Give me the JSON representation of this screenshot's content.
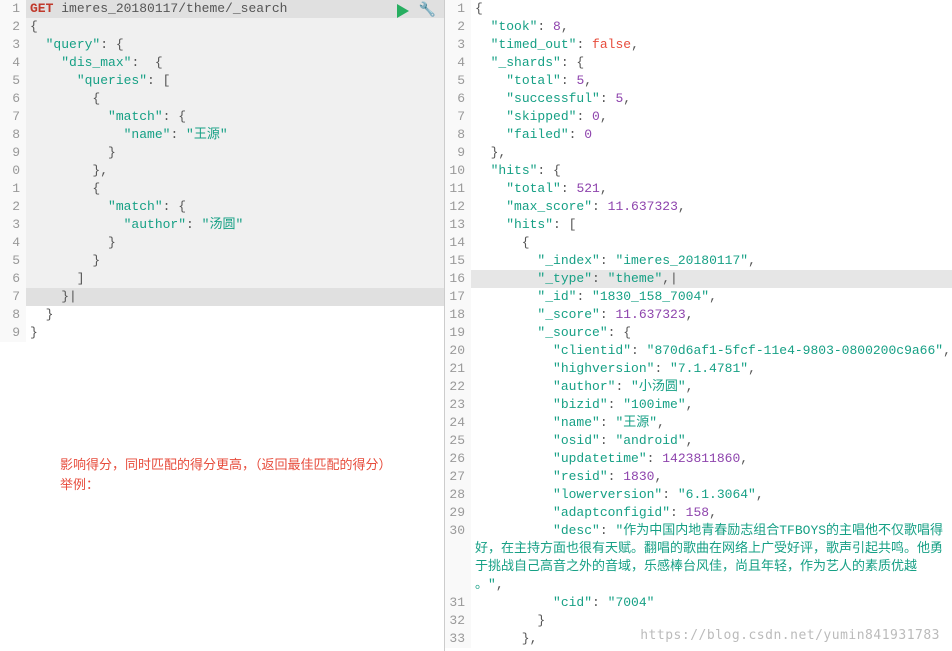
{
  "left": {
    "method": "GET",
    "endpoint": "imeres_20180117/theme/_search",
    "lines": [
      {
        "n": "1",
        "hl": true,
        "tokens": [
          {
            "t": "GET",
            "c": "method"
          },
          {
            "t": " "
          },
          {
            "t": "imeres_20180117/theme/_search",
            "c": "path"
          }
        ]
      },
      {
        "n": "2",
        "tokens": [
          {
            "t": "{",
            "c": "punc"
          }
        ]
      },
      {
        "n": "3",
        "tokens": [
          {
            "t": "  "
          },
          {
            "t": "\"query\"",
            "c": "key"
          },
          {
            "t": ": {",
            "c": "punc"
          }
        ]
      },
      {
        "n": "4",
        "tokens": [
          {
            "t": "    "
          },
          {
            "t": "\"dis_max\"",
            "c": "key"
          },
          {
            "t": ":  {",
            "c": "punc"
          }
        ]
      },
      {
        "n": "5",
        "tokens": [
          {
            "t": "      "
          },
          {
            "t": "\"queries\"",
            "c": "key"
          },
          {
            "t": ": [",
            "c": "punc"
          }
        ]
      },
      {
        "n": "6",
        "tokens": [
          {
            "t": "        {",
            "c": "punc"
          }
        ]
      },
      {
        "n": "7",
        "tokens": [
          {
            "t": "          "
          },
          {
            "t": "\"match\"",
            "c": "key"
          },
          {
            "t": ": {",
            "c": "punc"
          }
        ]
      },
      {
        "n": "8",
        "tokens": [
          {
            "t": "            "
          },
          {
            "t": "\"name\"",
            "c": "key"
          },
          {
            "t": ": ",
            "c": "punc"
          },
          {
            "t": "\"王源\"",
            "c": "str"
          }
        ]
      },
      {
        "n": "9",
        "tokens": [
          {
            "t": "          }",
            "c": "punc"
          }
        ]
      },
      {
        "n": "0",
        "tokens": [
          {
            "t": "        },",
            "c": "punc"
          }
        ]
      },
      {
        "n": "1",
        "tokens": [
          {
            "t": "        {",
            "c": "punc"
          }
        ]
      },
      {
        "n": "2",
        "tokens": [
          {
            "t": "          "
          },
          {
            "t": "\"match\"",
            "c": "key"
          },
          {
            "t": ": {",
            "c": "punc"
          }
        ]
      },
      {
        "n": "3",
        "tokens": [
          {
            "t": "            "
          },
          {
            "t": "\"author\"",
            "c": "key"
          },
          {
            "t": ": ",
            "c": "punc"
          },
          {
            "t": "\"汤圆\"",
            "c": "str"
          }
        ]
      },
      {
        "n": "4",
        "tokens": [
          {
            "t": "          }",
            "c": "punc"
          }
        ]
      },
      {
        "n": "5",
        "tokens": [
          {
            "t": "        }",
            "c": "punc"
          }
        ]
      },
      {
        "n": "6",
        "tokens": [
          {
            "t": "      ]",
            "c": "punc"
          }
        ]
      },
      {
        "n": "7",
        "hl": true,
        "tokens": [
          {
            "t": "    }|",
            "c": "punc"
          }
        ]
      },
      {
        "n": "8",
        "white": true,
        "tokens": [
          {
            "t": "  }",
            "c": "punc"
          }
        ]
      },
      {
        "n": "9",
        "white": true,
        "tokens": [
          {
            "t": "}",
            "c": "punc"
          }
        ]
      }
    ],
    "annotation_line1": "影响得分，同时匹配的得分更高，（返回最佳匹配的得分）",
    "annotation_line2": "举例："
  },
  "right": {
    "lines": [
      {
        "n": "1",
        "tokens": [
          {
            "t": "{",
            "c": "punc"
          }
        ]
      },
      {
        "n": "2",
        "tokens": [
          {
            "t": "  "
          },
          {
            "t": "\"took\"",
            "c": "key"
          },
          {
            "t": ": ",
            "c": "punc"
          },
          {
            "t": "8",
            "c": "num"
          },
          {
            "t": ",",
            "c": "punc"
          }
        ]
      },
      {
        "n": "3",
        "tokens": [
          {
            "t": "  "
          },
          {
            "t": "\"timed_out\"",
            "c": "key"
          },
          {
            "t": ": ",
            "c": "punc"
          },
          {
            "t": "false",
            "c": "bool"
          },
          {
            "t": ",",
            "c": "punc"
          }
        ]
      },
      {
        "n": "4",
        "tokens": [
          {
            "t": "  "
          },
          {
            "t": "\"_shards\"",
            "c": "key"
          },
          {
            "t": ": {",
            "c": "punc"
          }
        ]
      },
      {
        "n": "5",
        "tokens": [
          {
            "t": "    "
          },
          {
            "t": "\"total\"",
            "c": "key"
          },
          {
            "t": ": ",
            "c": "punc"
          },
          {
            "t": "5",
            "c": "num"
          },
          {
            "t": ",",
            "c": "punc"
          }
        ]
      },
      {
        "n": "6",
        "tokens": [
          {
            "t": "    "
          },
          {
            "t": "\"successful\"",
            "c": "key"
          },
          {
            "t": ": ",
            "c": "punc"
          },
          {
            "t": "5",
            "c": "num"
          },
          {
            "t": ",",
            "c": "punc"
          }
        ]
      },
      {
        "n": "7",
        "tokens": [
          {
            "t": "    "
          },
          {
            "t": "\"skipped\"",
            "c": "key"
          },
          {
            "t": ": ",
            "c": "punc"
          },
          {
            "t": "0",
            "c": "num"
          },
          {
            "t": ",",
            "c": "punc"
          }
        ]
      },
      {
        "n": "8",
        "tokens": [
          {
            "t": "    "
          },
          {
            "t": "\"failed\"",
            "c": "key"
          },
          {
            "t": ": ",
            "c": "punc"
          },
          {
            "t": "0",
            "c": "num"
          }
        ]
      },
      {
        "n": "9",
        "tokens": [
          {
            "t": "  },",
            "c": "punc"
          }
        ]
      },
      {
        "n": "10",
        "tokens": [
          {
            "t": "  "
          },
          {
            "t": "\"hits\"",
            "c": "key"
          },
          {
            "t": ": {",
            "c": "punc"
          }
        ]
      },
      {
        "n": "11",
        "tokens": [
          {
            "t": "    "
          },
          {
            "t": "\"total\"",
            "c": "key"
          },
          {
            "t": ": ",
            "c": "punc"
          },
          {
            "t": "521",
            "c": "num"
          },
          {
            "t": ",",
            "c": "punc"
          }
        ]
      },
      {
        "n": "12",
        "tokens": [
          {
            "t": "    "
          },
          {
            "t": "\"max_score\"",
            "c": "key"
          },
          {
            "t": ": ",
            "c": "punc"
          },
          {
            "t": "11.637323",
            "c": "num"
          },
          {
            "t": ",",
            "c": "punc"
          }
        ]
      },
      {
        "n": "13",
        "tokens": [
          {
            "t": "    "
          },
          {
            "t": "\"hits\"",
            "c": "key"
          },
          {
            "t": ": [",
            "c": "punc"
          }
        ]
      },
      {
        "n": "14",
        "tokens": [
          {
            "t": "      {",
            "c": "punc"
          }
        ]
      },
      {
        "n": "15",
        "tokens": [
          {
            "t": "        "
          },
          {
            "t": "\"_index\"",
            "c": "key"
          },
          {
            "t": ": ",
            "c": "punc"
          },
          {
            "t": "\"imeres_20180117\"",
            "c": "str"
          },
          {
            "t": ",",
            "c": "punc"
          }
        ]
      },
      {
        "n": "16",
        "hl": true,
        "tokens": [
          {
            "t": "        "
          },
          {
            "t": "\"_type\"",
            "c": "key"
          },
          {
            "t": ": ",
            "c": "punc"
          },
          {
            "t": "\"theme\"",
            "c": "str"
          },
          {
            "t": ",|",
            "c": "punc"
          }
        ]
      },
      {
        "n": "17",
        "tokens": [
          {
            "t": "        "
          },
          {
            "t": "\"_id\"",
            "c": "key"
          },
          {
            "t": ": ",
            "c": "punc"
          },
          {
            "t": "\"1830_158_7004\"",
            "c": "str"
          },
          {
            "t": ",",
            "c": "punc"
          }
        ]
      },
      {
        "n": "18",
        "tokens": [
          {
            "t": "        "
          },
          {
            "t": "\"_score\"",
            "c": "key"
          },
          {
            "t": ": ",
            "c": "punc"
          },
          {
            "t": "11.637323",
            "c": "num"
          },
          {
            "t": ",",
            "c": "punc"
          }
        ]
      },
      {
        "n": "19",
        "tokens": [
          {
            "t": "        "
          },
          {
            "t": "\"_source\"",
            "c": "key"
          },
          {
            "t": ": {",
            "c": "punc"
          }
        ]
      },
      {
        "n": "20",
        "wrap": true,
        "tokens": [
          {
            "t": "          "
          },
          {
            "t": "\"clientid\"",
            "c": "key"
          },
          {
            "t": ": ",
            "c": "punc"
          },
          {
            "t": "\"870d6af1-5fcf-11e4-9803-0800200c9a66\"",
            "c": "str"
          },
          {
            "t": ",",
            "c": "punc"
          }
        ]
      },
      {
        "n": "21",
        "tokens": [
          {
            "t": "          "
          },
          {
            "t": "\"highversion\"",
            "c": "key"
          },
          {
            "t": ": ",
            "c": "punc"
          },
          {
            "t": "\"7.1.4781\"",
            "c": "str"
          },
          {
            "t": ",",
            "c": "punc"
          }
        ]
      },
      {
        "n": "22",
        "tokens": [
          {
            "t": "          "
          },
          {
            "t": "\"author\"",
            "c": "key"
          },
          {
            "t": ": ",
            "c": "punc"
          },
          {
            "t": "\"小汤圆\"",
            "c": "str"
          },
          {
            "t": ",",
            "c": "punc"
          }
        ]
      },
      {
        "n": "23",
        "tokens": [
          {
            "t": "          "
          },
          {
            "t": "\"bizid\"",
            "c": "key"
          },
          {
            "t": ": ",
            "c": "punc"
          },
          {
            "t": "\"100ime\"",
            "c": "str"
          },
          {
            "t": ",",
            "c": "punc"
          }
        ]
      },
      {
        "n": "24",
        "tokens": [
          {
            "t": "          "
          },
          {
            "t": "\"name\"",
            "c": "key"
          },
          {
            "t": ": ",
            "c": "punc"
          },
          {
            "t": "\"王源\"",
            "c": "str"
          },
          {
            "t": ",",
            "c": "punc"
          }
        ]
      },
      {
        "n": "25",
        "tokens": [
          {
            "t": "          "
          },
          {
            "t": "\"osid\"",
            "c": "key"
          },
          {
            "t": ": ",
            "c": "punc"
          },
          {
            "t": "\"android\"",
            "c": "str"
          },
          {
            "t": ",",
            "c": "punc"
          }
        ]
      },
      {
        "n": "26",
        "tokens": [
          {
            "t": "          "
          },
          {
            "t": "\"updatetime\"",
            "c": "key"
          },
          {
            "t": ": ",
            "c": "punc"
          },
          {
            "t": "1423811860",
            "c": "num"
          },
          {
            "t": ",",
            "c": "punc"
          }
        ]
      },
      {
        "n": "27",
        "tokens": [
          {
            "t": "          "
          },
          {
            "t": "\"resid\"",
            "c": "key"
          },
          {
            "t": ": ",
            "c": "punc"
          },
          {
            "t": "1830",
            "c": "num"
          },
          {
            "t": ",",
            "c": "punc"
          }
        ]
      },
      {
        "n": "28",
        "tokens": [
          {
            "t": "          "
          },
          {
            "t": "\"lowerversion\"",
            "c": "key"
          },
          {
            "t": ": ",
            "c": "punc"
          },
          {
            "t": "\"6.1.3064\"",
            "c": "str"
          },
          {
            "t": ",",
            "c": "punc"
          }
        ]
      },
      {
        "n": "29",
        "tokens": [
          {
            "t": "          "
          },
          {
            "t": "\"adaptconfigid\"",
            "c": "key"
          },
          {
            "t": ": ",
            "c": "punc"
          },
          {
            "t": "158",
            "c": "num"
          },
          {
            "t": ",",
            "c": "punc"
          }
        ]
      },
      {
        "n": "30",
        "wrap": true,
        "tokens": [
          {
            "t": "          "
          },
          {
            "t": "\"desc\"",
            "c": "key"
          },
          {
            "t": ": ",
            "c": "punc"
          },
          {
            "t": "\"作为中国内地青春励志组合TFBOYS的主唱他不仅歌唱得好，在主持方面也很有天赋。翻唱的歌曲在网络上广受好评，歌声引起共鸣。他勇于挑战自己高音之外的音域，乐感棒台风佳，尚且年轻，作为艺人的素质优越 。\"",
            "c": "str"
          },
          {
            "t": ",",
            "c": "punc"
          }
        ]
      },
      {
        "n": "31",
        "tokens": [
          {
            "t": "          "
          },
          {
            "t": "\"cid\"",
            "c": "key"
          },
          {
            "t": ": ",
            "c": "punc"
          },
          {
            "t": "\"7004\"",
            "c": "str"
          }
        ]
      },
      {
        "n": "32",
        "tokens": [
          {
            "t": "        }",
            "c": "punc"
          }
        ]
      },
      {
        "n": "33",
        "tokens": [
          {
            "t": "      },",
            "c": "punc"
          }
        ]
      }
    ]
  },
  "watermark": "https://blog.csdn.net/yumin841931783"
}
